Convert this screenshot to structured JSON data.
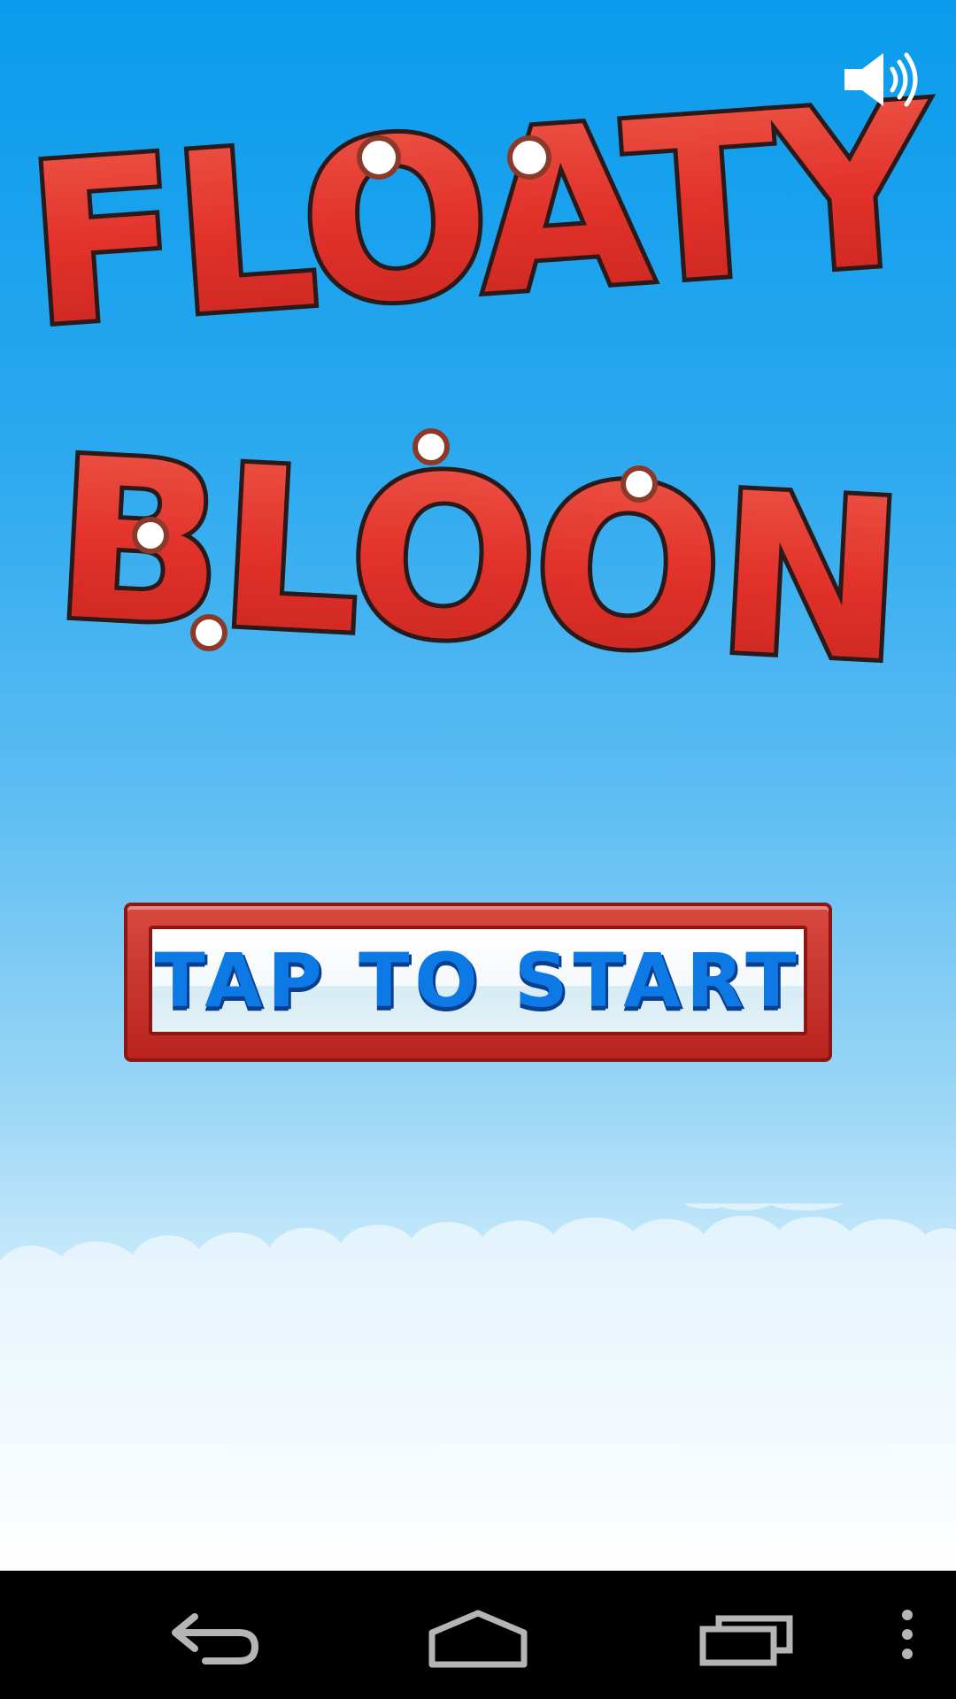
{
  "game": {
    "title_line1": "FLOATY",
    "title_line2": "BLOON",
    "start_label": "TAP TO START",
    "sound": {
      "icon": "speaker-on-icon",
      "state": "on"
    }
  },
  "colors": {
    "sky_top": "#0a9bec",
    "sky_bottom": "#ffffff",
    "balloon_red": "#e23b32",
    "button_red": "#c5302a",
    "start_text_blue": "#0d79e5"
  },
  "nav_bar": {
    "buttons": [
      {
        "name": "back",
        "icon": "back-arrow-icon"
      },
      {
        "name": "home",
        "icon": "home-icon"
      },
      {
        "name": "recents",
        "icon": "recent-apps-icon"
      },
      {
        "name": "menu",
        "icon": "overflow-menu-icon"
      }
    ]
  }
}
